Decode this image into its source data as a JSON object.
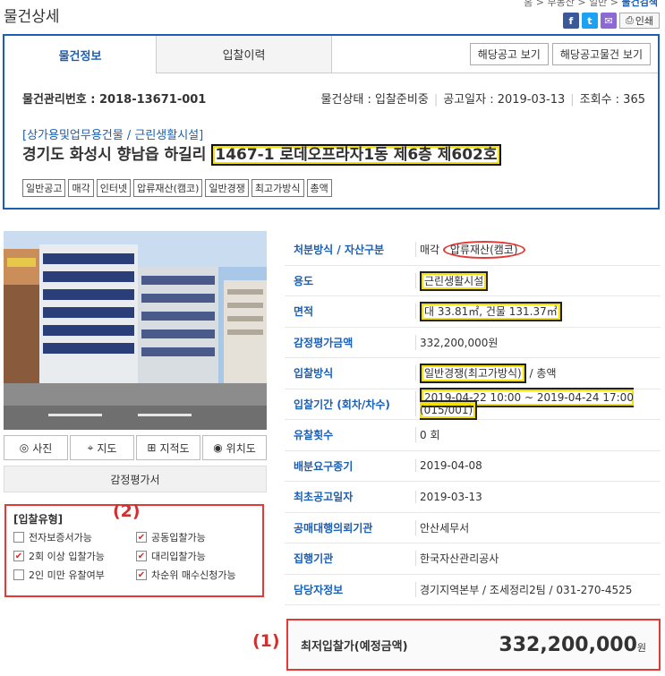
{
  "page_title": "물건상세",
  "breadcrumb": {
    "items": [
      "홈",
      "부동산",
      "일반"
    ],
    "current": "물건검색"
  },
  "share": {
    "facebook": "f",
    "twitter": "t",
    "mail": "✉",
    "print_label": "인쇄"
  },
  "tabs": [
    {
      "label": "물건정보"
    },
    {
      "label": "입찰이력"
    }
  ],
  "notice_buttons": {
    "view_notice": "해당공고 보기",
    "view_notice_items": "해당공고물건 보기"
  },
  "item": {
    "mgmt_no": "물건관리번호 : 2018-13671-001",
    "status": "물건상태 : 입찰준비중",
    "notice_date": "공고일자 : 2019-03-13",
    "views": "조회수 : 365",
    "category": "[상가용및업무용건물 / 근린생활시설]",
    "address_main": "경기도 화성시 향남읍 하길리 ",
    "address_hl": "1467-1 로데오프라자1동 제6층 제602호",
    "tags": [
      "일반공고",
      "매각",
      "인터넷",
      "압류재산(캠코)",
      "일반경쟁",
      "최고가방식",
      "총액"
    ]
  },
  "photo_tools": {
    "photo": "사진",
    "map": "지도",
    "cadastral": "지적도",
    "location": "위치도",
    "appraisal": "감정평가서"
  },
  "bid_type": {
    "title": "[입찰유형]",
    "items": [
      {
        "label": "전자보증서가능",
        "checked": false,
        "mark": ""
      },
      {
        "label": "공동입찰가능",
        "checked": true,
        "mark": "✔"
      },
      {
        "label": "2회 이상 입찰가능",
        "checked": true,
        "mark": "✔"
      },
      {
        "label": "대리입찰가능",
        "checked": true,
        "mark": "✔"
      },
      {
        "label": "2인 미만 유찰여부",
        "checked": false,
        "mark": ""
      },
      {
        "label": "차순위 매수신청가능",
        "checked": true,
        "mark": "✔"
      }
    ]
  },
  "labels": {
    "one": "(1)",
    "two": "(2)"
  },
  "details": {
    "disposal_label": "처분방식 / 자산구분",
    "disposal_a": "매각",
    "disposal_b": "압류재산(캠코)",
    "use_label": "용도",
    "use": "근린생활시설",
    "area_label": "면적",
    "area": "대 33.81㎡, 건물 131.37㎡",
    "appraisal_label": "감정평가금액",
    "appraisal": "332,200,000원",
    "method_label": "입찰방식",
    "method_hl": "일반경쟁(최고가방식)",
    "method_rest": " / 총액",
    "period_label": "입찰기간 (회차/차수)",
    "period": "2019-04-22 10:00 ~ 2019-04-24 17:00 (015/001)",
    "failed_label": "유찰횟수",
    "failed": "0 회",
    "dist_label": "배분요구종기",
    "dist": "2019-04-08",
    "first_notice_label": "최초공고일자",
    "first_notice": "2019-03-13",
    "agency_label": "공매대행의뢰기관",
    "agency": "안산세무서",
    "exec_label": "집행기관",
    "exec": "한국자산관리공사",
    "contact_label": "담당자정보",
    "contact": "경기지역본부 / 조세정리2팀 / 031-270-4525"
  },
  "min_bid": {
    "label": "최저입찰가(예정금액)",
    "amount": "332,200,000",
    "unit": "원"
  }
}
